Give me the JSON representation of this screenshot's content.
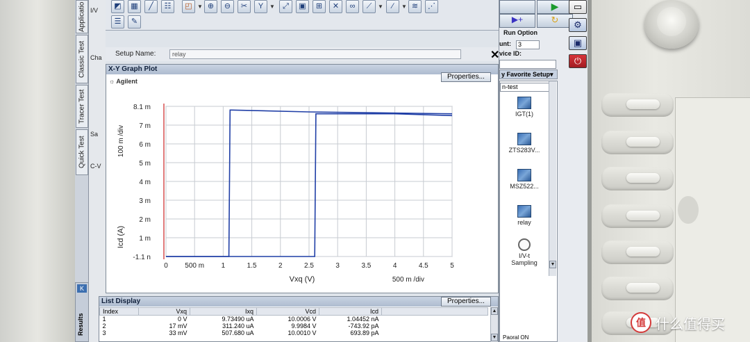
{
  "vertical_tabs": [
    "Applicatio",
    "Classic Test",
    "Tracer Test",
    "Quick Test",
    "Results"
  ],
  "left_strip_labels": [
    "I/V",
    "Cha",
    "Sa",
    "C-V"
  ],
  "toolbar_icons": [
    "graph-icon",
    "multi-plot-icon",
    "line-plot-icon",
    "table-icon",
    "marker-icon",
    "zoom-in-icon",
    "zoom-out-icon",
    "tools-icon",
    "y-axis-icon",
    "autoscale-icon",
    "image-icon",
    "grid-icon",
    "cursor-icon",
    "scale-icon",
    "line-fit-icon",
    "tangent-icon",
    "regression-icon",
    "mark-icon",
    "list-icon",
    "edit-icon"
  ],
  "setup": {
    "label": "Setup Name:",
    "value": "relay"
  },
  "graph": {
    "title": "X-Y Graph Plot",
    "properties_label": "Properties...",
    "brand": "Agilent",
    "y_per_div": "100 m /div",
    "x_per_div": "500 m /div"
  },
  "chart_data": {
    "type": "line",
    "xlabel": "Vxq (V)",
    "ylabel": "Icd (A)",
    "xlim": [
      0,
      5
    ],
    "ylim": [
      -1.1e-09,
      0.0081
    ],
    "x_ticks": [
      "0",
      "500 m",
      "1",
      "1.5",
      "2",
      "2.5",
      "3",
      "3.5",
      "4",
      "4.5",
      "5"
    ],
    "y_ticks": [
      "-1.1 n",
      "1 m",
      "2 m",
      "3 m",
      "4 m",
      "5 m",
      "6 m",
      "7 m",
      "8.1 m"
    ],
    "grid": true,
    "series": [
      {
        "x": [
          0,
          1.1,
          1.12,
          1.15,
          2.5,
          5
        ],
        "y": [
          0,
          0,
          0.0079,
          0.0079,
          0.0078,
          0.0077
        ]
      },
      {
        "x": [
          0,
          2.6,
          2.62,
          2.65,
          4,
          5
        ],
        "y": [
          0,
          0,
          0.0077,
          0.0077,
          0.0077,
          0.0076
        ]
      }
    ]
  },
  "list_display": {
    "title": "List Display",
    "properties_label": "Properties...",
    "columns": [
      "Index",
      "Vxq",
      "Ixq",
      "Vcd",
      "Icd"
    ],
    "rows": [
      [
        "1",
        "0 V",
        "9.73490 uA",
        "10.0006 V",
        "1.04452 nA"
      ],
      [
        "2",
        "17 mV",
        "311.240 uA",
        "9.9984 V",
        "-743.92 pA"
      ],
      [
        "3",
        "33 mV",
        "507.680 uA",
        "10.0010 V",
        "693.89 pA"
      ]
    ]
  },
  "right_panel": {
    "run_option": "Run Option",
    "count_label": "unt:",
    "count_value": "3",
    "device_label": "vice ID:",
    "favorite_header": "y Favorite Setup",
    "dropdown_value": "n-test",
    "items": [
      "IGT(1)",
      "ZTS283V...",
      "MSZ522...",
      "relay"
    ],
    "sampling_label_1": "I/V-t",
    "sampling_label_2": "Sampling",
    "bottom_text": "Paoral ON"
  },
  "watermark": {
    "text": "什么值得买",
    "logo": "值"
  }
}
